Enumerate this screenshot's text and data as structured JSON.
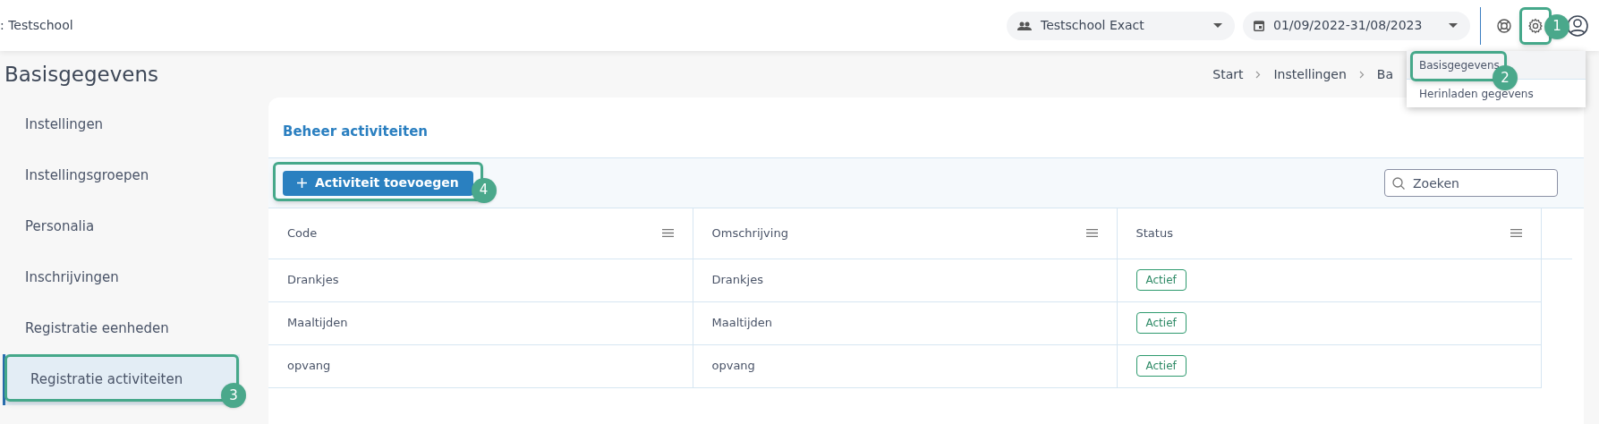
{
  "header": {
    "school_label": ": Testschool",
    "school_select": "Testschool Exact",
    "period_select": "01/09/2022-31/08/2023",
    "settings_callout": "1"
  },
  "settings_menu": [
    {
      "label": "Basisgegevens",
      "selected": true,
      "callout": "2"
    },
    {
      "label": "Herinladen gegevens",
      "selected": false
    }
  ],
  "page_title": "Basisgegevens",
  "breadcrumb": [
    "Start",
    "Instellingen",
    "Ba"
  ],
  "sidebar": {
    "items": [
      {
        "label": "Instellingen",
        "selected": false
      },
      {
        "label": "Instellingsgroepen",
        "selected": false
      },
      {
        "label": "Personalia",
        "selected": false
      },
      {
        "label": "Inschrijvingen",
        "selected": false
      },
      {
        "label": "Registratie eenheden",
        "selected": false
      },
      {
        "label": "Registratie activiteiten",
        "selected": true,
        "callout": "3"
      }
    ]
  },
  "card": {
    "title": "Beheer activiteiten",
    "add_button": {
      "label": "Activiteit toevoegen",
      "callout": "4"
    },
    "search": {
      "placeholder": "Zoeken"
    },
    "table": {
      "columns": [
        "Code",
        "Omschrijving",
        "Status"
      ],
      "rows": [
        {
          "code": "Drankjes",
          "description": "Drankjes",
          "status": "Actief"
        },
        {
          "code": "Maaltijden",
          "description": "Maaltijden",
          "status": "Actief"
        },
        {
          "code": "opvang",
          "description": "opvang",
          "status": "Actief"
        }
      ]
    }
  }
}
